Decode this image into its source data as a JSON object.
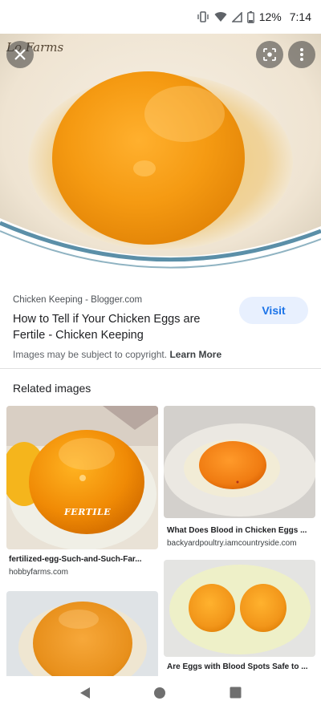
{
  "status_bar": {
    "battery": "12%",
    "time": "7:14"
  },
  "hero": {
    "watermark": "Lo Farms"
  },
  "source": {
    "name": "Chicken Keeping - Blogger.com",
    "title": "How to Tell if Your Chicken Eggs are Fertile - Chicken Keeping",
    "copyright_text": "Images may be subject to copyright.",
    "learn_more": "Learn More",
    "visit_label": "Visit"
  },
  "related": {
    "heading": "Related images",
    "items": [
      {
        "title": "fertilized-egg-Such-and-Such-Far...",
        "domain": "hobbyfarms.com",
        "overlay": "FERTILE"
      },
      {
        "title": "What Does Blood in Chicken Eggs ...",
        "domain": "backyardpoultry.iamcountryside.com"
      },
      {
        "title": "",
        "domain": ""
      },
      {
        "title": "Are Eggs with Blood Spots Safe to ...",
        "domain": ""
      }
    ]
  },
  "colors": {
    "accent": "#1a73e8",
    "visit_bg": "#e8f0fe"
  }
}
